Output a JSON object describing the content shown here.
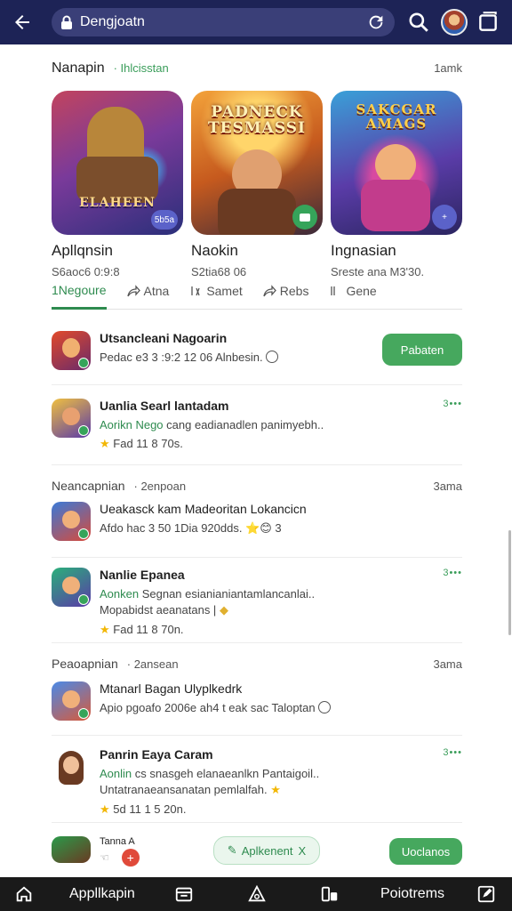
{
  "browser": {
    "url": "Dengjoatn",
    "icons": [
      "back-arrow-icon",
      "lock-icon",
      "reload-icon",
      "search-icon",
      "avatar",
      "tabs-icon"
    ]
  },
  "featured_section": {
    "title": "Nanapin",
    "subtitle": "· Ihlcisstan",
    "right": "1amk"
  },
  "cards": [
    {
      "title": "Apllqnsin",
      "meta": "S6aoc6 0:9:8",
      "badge": "5b5a",
      "art": "ELAHEEN"
    },
    {
      "title": "Naokin",
      "meta": "S2tia68 06",
      "badge": "",
      "art": "PADNECK TESMASSI"
    },
    {
      "title": "Ingnasian",
      "meta": "Sreste ana M3'30.",
      "badge": "+",
      "art": "SAKCGAR AMAGS"
    }
  ],
  "tabs": [
    {
      "label": "1Negoure",
      "icon": ""
    },
    {
      "label": "Atna",
      "icon": "share-icon"
    },
    {
      "label": "Samet",
      "icon": "text-icon"
    },
    {
      "label": "Rebs",
      "icon": "share-icon"
    },
    {
      "label": "Gene",
      "icon": "text-icon"
    }
  ],
  "list": {
    "row1": {
      "title": "Utsancleani Nagoarin",
      "line": "Pedac e3 3 :9:2 12 06 Alnbesin.",
      "button": "Pabaten"
    },
    "row2": {
      "title": "Uanlia Searl lantadam",
      "line_green": "Aorikn Nego",
      "line_rest": " cang eadianadlen panimyebh..",
      "rating": "Fad 11 8 70s.",
      "more": "3•••"
    },
    "group2": {
      "title": "Neancapnian",
      "sub": "· 2enpoan",
      "right": "3ama"
    },
    "row3": {
      "title": "Ueakasck kam Madeoritan Lokancicn",
      "line": "Afdo hac 3 50 1Dia 920dds.",
      "stars": "⭐😊 3"
    },
    "row4": {
      "title": "Nanlie Epanea",
      "line_green": "Aonken",
      "line_rest": " Segnan esianianiantamlancanlai..",
      "line2": "Mopabidst aeanatans |",
      "rating": "Fad 11 8 70n.",
      "more": "3•••"
    },
    "group3": {
      "title": "Peaoapnian",
      "sub": "· 2ansean",
      "right": "3ama"
    },
    "row5": {
      "title": "Mtanarl Bagan Ulyplkedrk",
      "line": "Apio pgoafo 2006e ah4 t eak sac Taloptan"
    },
    "row6": {
      "title": "Panrin Eaya Caram",
      "line_green": "Aonlin",
      "line_rest": " cs snasgeh elanaeanlkn Pantaigoil..",
      "line2": "Untatranaeansanatan pemlalfah.",
      "rating": "5d 11 1 5 20n.",
      "more": "3•••"
    },
    "row7": {
      "title": "Tanna A",
      "ghost_button": "Aplkenent",
      "ghost_close": "X",
      "button": "Uoclanos"
    }
  },
  "bottom_nav": [
    {
      "label": "",
      "icon": "home-icon"
    },
    {
      "label": "Appllkapin",
      "icon": ""
    },
    {
      "label": "",
      "icon": "calendar-icon"
    },
    {
      "label": "",
      "icon": "alert-icon"
    },
    {
      "label": "",
      "icon": "library-icon"
    },
    {
      "label": "Poiotrems",
      "icon": ""
    },
    {
      "label": "",
      "icon": "edit-icon"
    }
  ],
  "colors": {
    "topbar": "#1d2356",
    "accent_green": "#46a85e",
    "badge_purple": "#5b62c9",
    "bottom_nav": "#1a1a1a"
  }
}
